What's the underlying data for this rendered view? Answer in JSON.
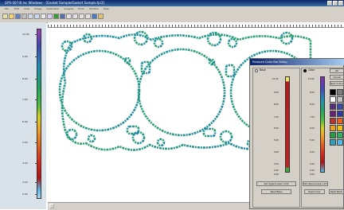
{
  "window": {
    "title": "GPS-S07-B Inc Windows - [Gasket Sample/Gasket Sample.fpi3]"
  },
  "menu": {
    "items": [
      "File",
      "Edit",
      "View",
      "Image",
      "Calibration",
      "Analysis",
      "Tools",
      "Window",
      "Help"
    ]
  },
  "legend": {
    "ticks": [
      "10.00",
      "9.00",
      "8.00",
      "7.00",
      "6.00",
      "5.00",
      "4.00",
      "3.00",
      "2.00"
    ]
  },
  "dialog": {
    "title": "Pressure Color Bar Setup",
    "base_group": {
      "label": "Base",
      "ticks": [
        "10.00",
        "9.00",
        "8.00",
        "7.00",
        "6.00",
        "5.00",
        "4.00",
        "3.00",
        "2.00",
        "0.00"
      ],
      "set_button": "Set Upper/Lower Limit",
      "read_button": "Read Base"
    },
    "color_group": {
      "label": "Color",
      "ticks": [
        "10.00",
        "9.00",
        "8.00",
        "7.00",
        "6.00",
        "5.00",
        "4.00",
        "3.00",
        "2.00",
        "0.00"
      ],
      "set_button": "Set Upper/Lower Limit",
      "read_button": "Read Color",
      "read_button_2": "Read Restr"
    },
    "ok_button": "OK",
    "cancel_button": "Cancel",
    "new_colors_button": "New Colors",
    "palette": [
      "#000000",
      "#7f7f7f",
      "#ffffff",
      "#c0c0c0",
      "#5a2d82",
      "#3b4ba8",
      "#6a1f7a",
      "#2e3a9e",
      "#c03030",
      "#f06020",
      "#e8a020",
      "#f0c020",
      "#20a040",
      "#30b060",
      "#30a0c0",
      "#58b8e8"
    ]
  }
}
